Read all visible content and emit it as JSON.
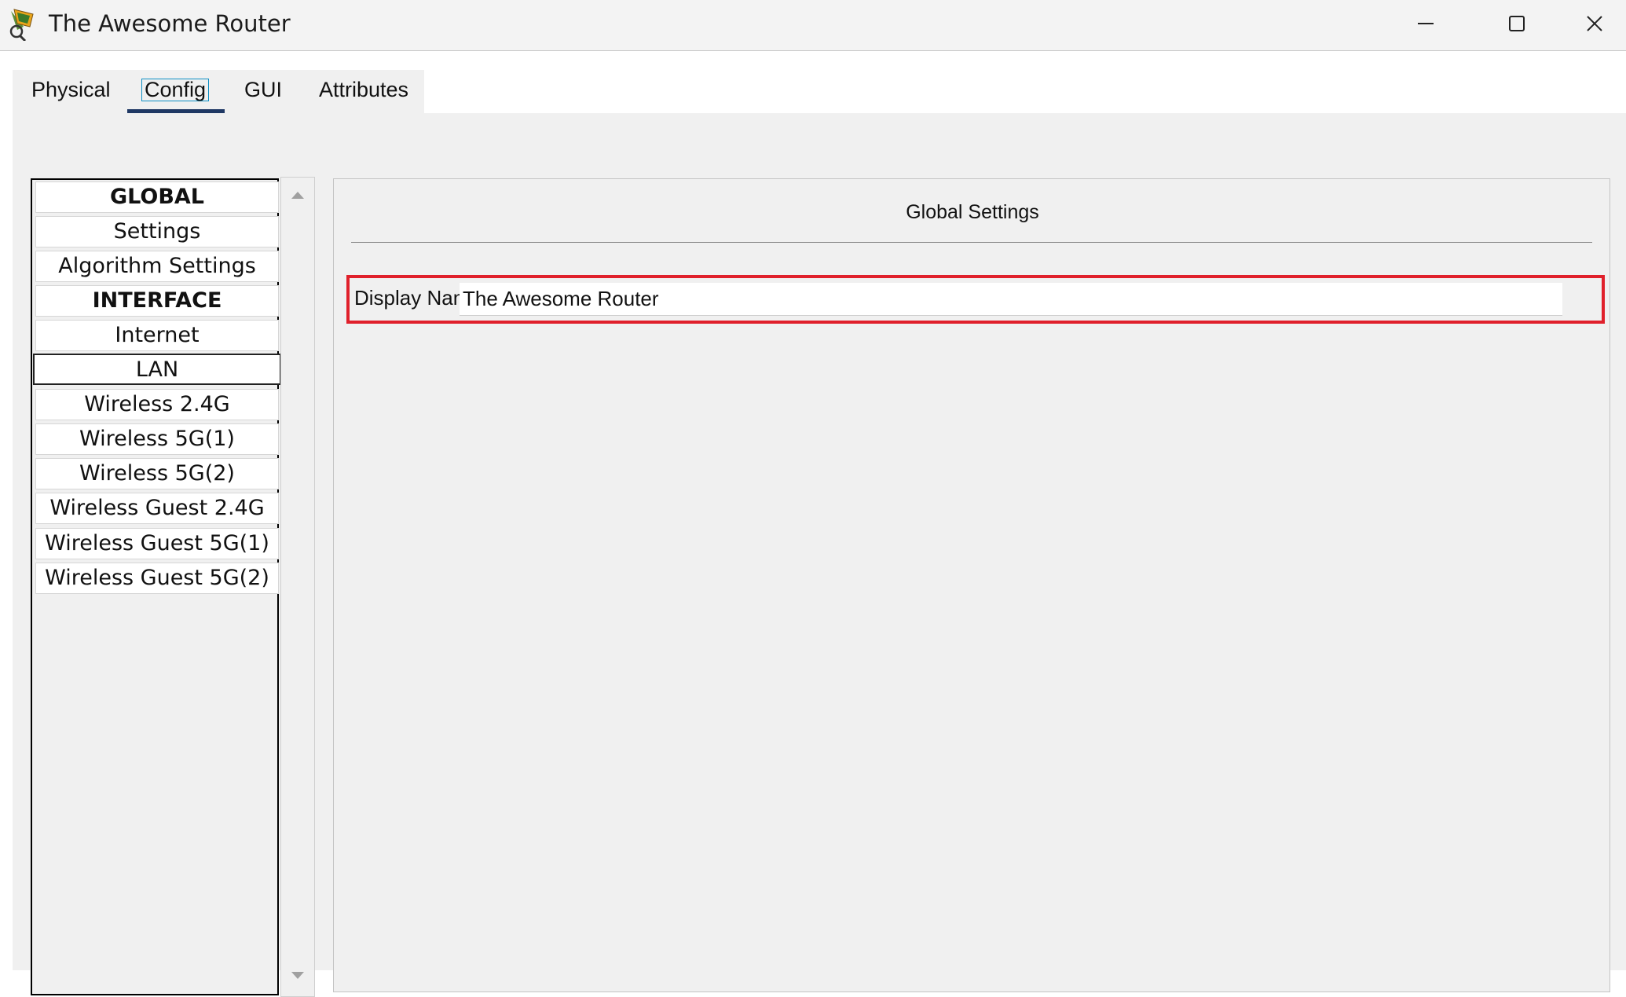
{
  "window": {
    "title": "The Awesome Router",
    "icons": {
      "app": "router-device-icon",
      "minimize": "minimize-icon",
      "maximize": "maximize-icon",
      "close": "close-icon"
    }
  },
  "tabs": [
    {
      "label": "Physical",
      "selected": false
    },
    {
      "label": "Config",
      "selected": true
    },
    {
      "label": "GUI",
      "selected": false
    },
    {
      "label": "Attributes",
      "selected": false
    }
  ],
  "sidebar": {
    "items": [
      {
        "label": "GLOBAL",
        "type": "header"
      },
      {
        "label": "Settings",
        "type": "item"
      },
      {
        "label": "Algorithm Settings",
        "type": "item"
      },
      {
        "label": "INTERFACE",
        "type": "header"
      },
      {
        "label": "Internet",
        "type": "item"
      },
      {
        "label": "LAN",
        "type": "item",
        "selected": true
      },
      {
        "label": "Wireless 2.4G",
        "type": "item"
      },
      {
        "label": "Wireless 5G(1)",
        "type": "item"
      },
      {
        "label": "Wireless 5G(2)",
        "type": "item"
      },
      {
        "label": "Wireless Guest 2.4G",
        "type": "item"
      },
      {
        "label": "Wireless Guest 5G(1)",
        "type": "item"
      },
      {
        "label": "Wireless Guest 5G(2)",
        "type": "item"
      }
    ],
    "scroll_icons": {
      "up": "scroll-up-arrow-icon",
      "down": "scroll-down-arrow-icon"
    }
  },
  "panel": {
    "title": "Global Settings",
    "display_name": {
      "label": "Display Name",
      "value": "The Awesome Router"
    }
  },
  "colors": {
    "highlight_border": "#e0202b",
    "tab_underline": "#1f3864",
    "focus_outline": "#0e8fc4"
  }
}
